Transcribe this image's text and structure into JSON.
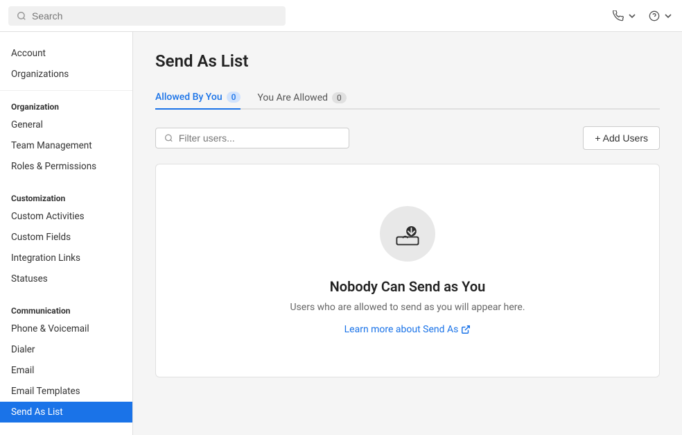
{
  "topbar": {
    "search_placeholder": "Search",
    "phone_icon": "phone-icon",
    "help_icon": "help-icon"
  },
  "sidebar": {
    "top_items": [
      {
        "id": "account",
        "label": "Account"
      },
      {
        "id": "organizations",
        "label": "Organizations"
      }
    ],
    "sections": [
      {
        "id": "organization",
        "title": "Organization",
        "items": [
          {
            "id": "general",
            "label": "General"
          },
          {
            "id": "team-management",
            "label": "Team Management"
          },
          {
            "id": "roles-permissions",
            "label": "Roles & Permissions"
          }
        ]
      },
      {
        "id": "customization",
        "title": "Customization",
        "items": [
          {
            "id": "custom-activities",
            "label": "Custom Activities"
          },
          {
            "id": "custom-fields",
            "label": "Custom Fields"
          },
          {
            "id": "integration-links",
            "label": "Integration Links"
          },
          {
            "id": "statuses",
            "label": "Statuses"
          }
        ]
      },
      {
        "id": "communication",
        "title": "Communication",
        "items": [
          {
            "id": "phone-voicemail",
            "label": "Phone & Voicemail"
          },
          {
            "id": "dialer",
            "label": "Dialer"
          },
          {
            "id": "email",
            "label": "Email"
          },
          {
            "id": "email-templates",
            "label": "Email Templates"
          },
          {
            "id": "send-as-list",
            "label": "Send As List",
            "active": true
          }
        ]
      }
    ]
  },
  "page": {
    "title": "Send As List",
    "tabs": [
      {
        "id": "allowed-by-you",
        "label": "Allowed By You",
        "count": "0",
        "active": true
      },
      {
        "id": "you-are-allowed",
        "label": "You Are Allowed",
        "count": "0",
        "active": false
      }
    ],
    "filter_placeholder": "Filter users...",
    "add_users_label": "+ Add Users",
    "empty_state": {
      "title": "Nobody Can Send as You",
      "subtitle": "Users who are allowed to send as you will appear here.",
      "learn_more_label": "Learn more about Send As",
      "learn_more_icon": "external-link-icon"
    }
  }
}
